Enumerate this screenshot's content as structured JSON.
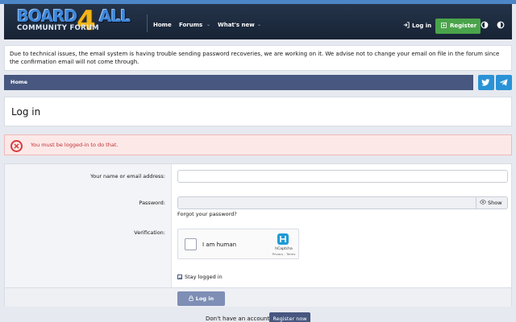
{
  "header": {
    "logo": {
      "line1": "BOARD",
      "four": "4",
      "line1b": "ALL",
      "line2": "COMMUNITY FORUM"
    },
    "nav": [
      {
        "label": "Home"
      },
      {
        "label": "Forums"
      },
      {
        "label": "What's new"
      }
    ],
    "login_label": "Log in",
    "register_label": "Register"
  },
  "notice": {
    "text": "Due to technical issues, the email system is having trouble sending password recoveries, we are working on it. We advise not to change your email on file in the forum since the confirmation email will not come through."
  },
  "breadcrumb": {
    "home": "Home"
  },
  "page": {
    "title": "Log in"
  },
  "error": {
    "message": "You must be logged-in to do that."
  },
  "form": {
    "name_label": "Your name or email address:",
    "name_value": "",
    "password_label": "Password:",
    "password_value": "",
    "show_label": "Show",
    "forgot_label": "Forgot your password?",
    "verification_label": "Verification:",
    "captcha": {
      "label": "I am human",
      "brand": "hCaptcha",
      "terms": "Privacy - Terms"
    },
    "stay_label": "Stay logged in",
    "stay_checked": true,
    "submit_label": "Log in"
  },
  "footer": {
    "no_account": "Don't have an account?",
    "register_now": "Register now"
  },
  "colors": {
    "header_bg": "#1e2b40",
    "accent_bar": "#4c86c7",
    "register_green": "#4aa44a",
    "breadcrumb_bg": "#47577f",
    "share_blue": "#2a92d6",
    "error_red": "#d63c3c",
    "button_blue": "#7e8eb5"
  }
}
